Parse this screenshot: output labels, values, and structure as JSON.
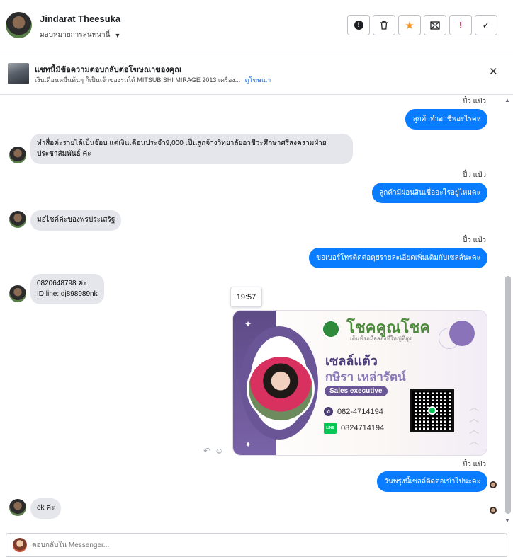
{
  "header": {
    "name": "Jindarat Theesuka",
    "assign_label": "มอบหมายการสนทนานี้",
    "toolbar": [
      {
        "name": "info-button",
        "icon": "info-icon",
        "glyph": "❶"
      },
      {
        "name": "delete-button",
        "icon": "trash-icon",
        "glyph": "🗑"
      },
      {
        "name": "star-button",
        "icon": "star-icon",
        "glyph": "★"
      },
      {
        "name": "mark-unread-button",
        "icon": "mail-icon",
        "glyph": "✉"
      },
      {
        "name": "spam-button",
        "icon": "exclamation-icon",
        "glyph": "!"
      },
      {
        "name": "done-button",
        "icon": "check-icon",
        "glyph": "✓"
      }
    ]
  },
  "ad": {
    "title": "แชทนี้มีข้อความตอบกลับต่อโฆษณาของคุณ",
    "description": "เงินเดือนหมื่นต้นๆ ก็เป็นเจ้าของรถได้ MITSUBISHI MIRAGE 2013 เครือง...",
    "link": "ดูโฆษณา"
  },
  "messages": {
    "seen": "ปิ๋ว แป๋ว",
    "out1": "ลูกค้าทำอาชีพอะไรคะ",
    "in1_line1": "ทำสื่อค่ะรายได้เป็นจ๊อบ แต่เงินเดือนประจำ9,000 เป็นลูกจ้างวิทยาลัยอาชีวะศึกษาศรีสงครามฝ่าย",
    "in1_line2": "ประชาสัมพันธ์ ค่ะ",
    "out2": "ลูกค้ามีผ่อนสินเชื่ออะไรอยู่ไหมคะ",
    "in2": "มอไซค์ค่ะของพรประเสริฐ",
    "out3": "ขอเบอร์โทรติดต่อคุยรายละเอียดเพิ่มเติมกับเซลล์นะคะ",
    "in3_line1": "0820648798 ค่ะ",
    "in3_line2": "ID line: dj898989nk",
    "timestamp": "19:57",
    "out4": "วันพรุ่งนี้เซลล์ติดต่อเข้าไปนะคะ",
    "in4": "ok ค่ะ"
  },
  "card": {
    "brand": "โชคคูณโชค",
    "tagline": "เต็นท์รถมือสองที่ใหญ่ที่สุด",
    "role": "เซลล์แต้ว",
    "person": "กษิรา เหล่ารัตน์",
    "badge": "Sales executive",
    "phone": "082-4714194",
    "line_id": "0824714194",
    "line_label": "LINE"
  },
  "composer": {
    "placeholder": "ตอบกลับใน Messenger..."
  },
  "colors": {
    "accent": "#0a7cff",
    "incoming_bubble": "#e4e6eb",
    "card_purple": "#6a5597"
  }
}
